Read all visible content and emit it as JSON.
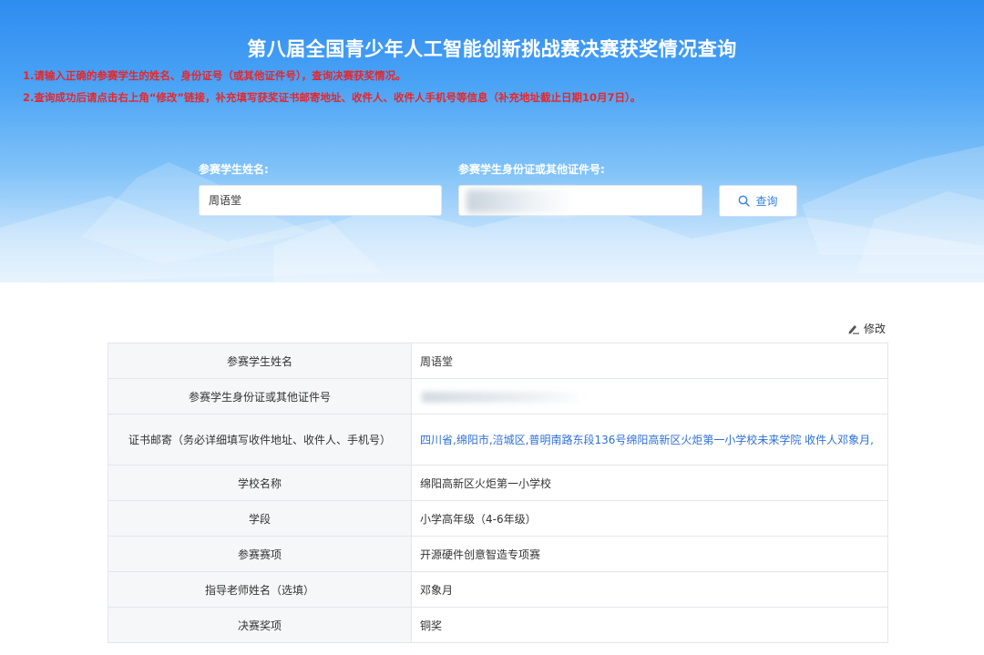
{
  "header": {
    "title": "第八届全国青少年人工智能创新挑战赛决赛获奖情况查询",
    "notices": [
      "1.请输入正确的参赛学生的姓名、身份证号（或其他证件号），查询决赛获奖情况。",
      "2.查询成功后请点击右上角“修改”链接，补充填写获奖证书邮寄地址、收件人、收件人手机号等信息（补充地址截止日期10月7日）。"
    ]
  },
  "search": {
    "name_label": "参赛学生姓名:",
    "name_value": "周语堂",
    "id_label": "参赛学生身份证或其他证件号:",
    "id_value": "",
    "button_label": "查询"
  },
  "result": {
    "edit_label": "修改",
    "rows": [
      {
        "label": "参赛学生姓名",
        "value": "周语堂"
      },
      {
        "label": "参赛学生身份证或其他证件号",
        "value": ""
      },
      {
        "label": "证书邮寄（务必详细填写收件地址、收件人、手机号）",
        "value": "四川省,绵阳市,涪城区,普明南路东段136号绵阳高新区火炬第一小学校未来学院 收件人邓象月,"
      },
      {
        "label": "学校名称",
        "value": "绵阳高新区火炬第一小学校"
      },
      {
        "label": "学段",
        "value": "小学高年级（4-6年级）"
      },
      {
        "label": "参赛赛项",
        "value": "开源硬件创意智造专项赛"
      },
      {
        "label": "指导老师姓名（选填）",
        "value": "邓象月"
      },
      {
        "label": "决赛奖项",
        "value": "铜奖"
      }
    ]
  },
  "colors": {
    "hero_top": "#2e8cf0",
    "notice_red": "#e8262b",
    "link_blue": "#2f6fd8",
    "button_blue": "#2f7fe4"
  },
  "icons": {
    "search": "search-icon",
    "edit": "edit-icon"
  }
}
